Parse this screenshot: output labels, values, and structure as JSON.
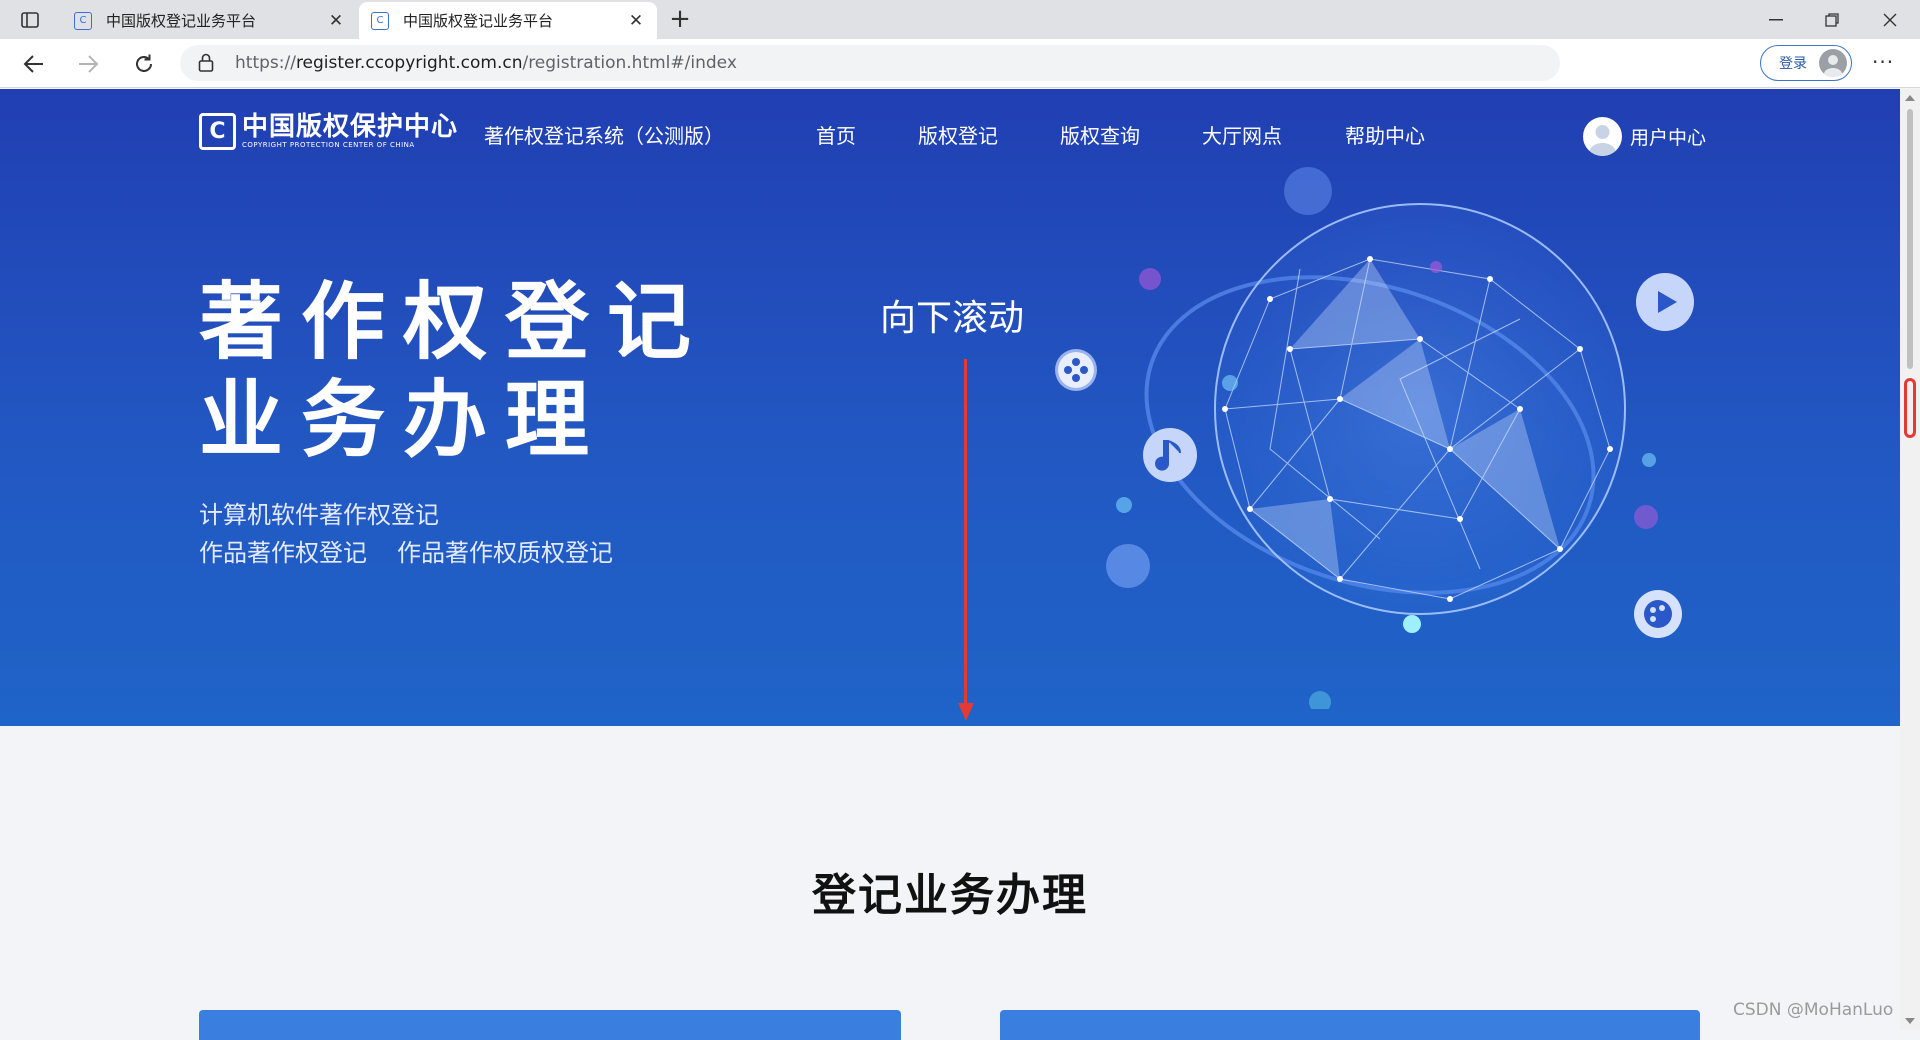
{
  "browser": {
    "tabs": [
      {
        "title": "中国版权登记业务平台",
        "favicon": "C",
        "active": false
      },
      {
        "title": "中国版权登记业务平台",
        "favicon": "C",
        "active": true
      }
    ],
    "url_prefix": "https://",
    "url_host": "register.ccopyright.com.cn",
    "url_path": "/registration.html#/index",
    "login_label": "登录",
    "icons": [
      "tab-actions-icon",
      "new-tab-icon",
      "minimize-icon",
      "restore-icon",
      "close-window-icon",
      "back-icon",
      "forward-icon",
      "refresh-icon",
      "lock-icon",
      "add-favorite-icon",
      "extensions-icon",
      "favorites-icon",
      "collections-icon",
      "more-icon"
    ]
  },
  "header": {
    "logo_cn": "中国版权保护中心",
    "logo_en": "COPYRIGHT PROTECTION CENTER OF CHINA",
    "logo_mark": "C",
    "system_name": "著作权登记系统（公测版）",
    "nav": [
      "首页",
      "版权登记",
      "版权查询",
      "大厅网点",
      "帮助中心"
    ],
    "user_center": "用户中心"
  },
  "hero": {
    "title_line1": "著作权登记",
    "title_line2": "业务办理",
    "sub_line1": "计算机软件著作权登记",
    "sub_line2a": "作品著作权登记",
    "sub_line2b": "作品著作权质权登记",
    "annotation": "向下滚动"
  },
  "section": {
    "title": "登记业务办理"
  },
  "watermark": "CSDN @MoHanLuo",
  "colors": {
    "hero_top": "#213fb2",
    "hero_bottom": "#1f64c8",
    "annotation_red": "#e53935",
    "card_blue": "#3a7ee0"
  }
}
